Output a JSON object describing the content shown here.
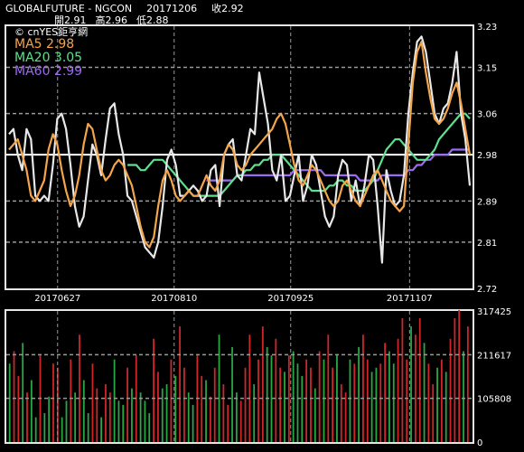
{
  "header": {
    "symbol": "GLOBALFUTURE - NGCON",
    "date": "20171206",
    "close_label": "收2.92",
    "open_label": "開2.91",
    "high_label": "高2.96",
    "low_label": "低2.88"
  },
  "legend": {
    "brand": "© cnYES鉅亨網",
    "ma5": "MA5 2.98",
    "ma20": "MA20 3.05",
    "ma60": "MA60 2.99"
  },
  "colors": {
    "price": "#e8e8e8",
    "ma5": "#f5a54a",
    "ma20": "#5ee08e",
    "ma60": "#9b6cf0",
    "vol_up": "#d0262a",
    "vol_down": "#28a745",
    "grid": "#9a9a9a",
    "last_price_line": "#ffffff"
  },
  "chart_data": [
    {
      "type": "line",
      "y_ticks": [
        "3.23",
        "3.15",
        "3.06",
        "2.98",
        "2.89",
        "2.81",
        "2.72"
      ],
      "ylim": [
        2.72,
        3.23
      ],
      "x_tick_labels": [
        "20170627",
        "20170810",
        "20170925",
        "20171107"
      ],
      "last_price_line": 2.98,
      "series": [
        {
          "name": "MA5",
          "values": [
            2.99,
            3.0,
            3.01,
            2.98,
            2.95,
            2.9,
            2.89,
            2.91,
            2.93,
            2.99,
            3.02,
            3.0,
            2.95,
            2.91,
            2.88,
            2.9,
            2.94,
            3.0,
            3.04,
            3.03,
            2.99,
            2.95,
            2.93,
            2.94,
            2.96,
            2.97,
            2.96,
            2.94,
            2.92,
            2.88,
            2.84,
            2.81,
            2.8,
            2.82,
            2.88,
            2.93,
            2.95,
            2.93,
            2.9,
            2.89,
            2.9,
            2.91,
            2.9,
            2.9,
            2.92,
            2.94,
            2.92,
            2.91,
            2.93,
            2.98,
            3.0,
            2.99,
            2.96,
            2.95,
            2.96,
            2.98,
            2.99,
            3.0,
            3.01,
            3.02,
            3.03,
            3.05,
            3.06,
            3.04,
            3.0,
            2.96,
            2.93,
            2.92,
            2.94,
            2.96,
            2.95,
            2.93,
            2.91,
            2.89,
            2.88,
            2.89,
            2.92,
            2.93,
            2.91,
            2.89,
            2.88,
            2.9,
            2.92,
            2.94,
            2.95,
            2.93,
            2.91,
            2.89,
            2.88,
            2.87,
            2.88,
            3.0,
            3.12,
            3.18,
            3.2,
            3.14,
            3.09,
            3.05,
            3.04,
            3.05,
            3.07,
            3.1,
            3.12,
            3.08,
            3.03,
            2.98
          ]
        },
        {
          "name": "MA20",
          "values": [
            2.96,
            2.96,
            2.96,
            2.95,
            2.95,
            2.96,
            2.97,
            2.97,
            2.97,
            2.96,
            2.95,
            2.94,
            2.93,
            2.92,
            2.91,
            2.9,
            2.9,
            2.9,
            2.9,
            2.9,
            2.9,
            2.9,
            2.91,
            2.92,
            2.93,
            2.94,
            2.94,
            2.95,
            2.95,
            2.96,
            2.96,
            2.97,
            2.97,
            2.98,
            2.98,
            2.98,
            2.97,
            2.96,
            2.95,
            2.94,
            2.93,
            2.92,
            2.91,
            2.91,
            2.91,
            2.91,
            2.92,
            2.92,
            2.93,
            2.93,
            2.92,
            2.92,
            2.91,
            2.91,
            2.91,
            2.92,
            2.93,
            2.95,
            2.97,
            2.99,
            3.0,
            3.01,
            3.01,
            3.0,
            2.99,
            2.98,
            2.97,
            2.97,
            2.97,
            2.98,
            2.99,
            3.01,
            3.02,
            3.03,
            3.04,
            3.05,
            3.06,
            3.06,
            3.05
          ],
          "start_index": 27
        },
        {
          "name": "MA60",
          "values": [
            2.93,
            2.93,
            2.93,
            2.93,
            2.93,
            2.93,
            2.93,
            2.94,
            2.94,
            2.94,
            2.94,
            2.94,
            2.94,
            2.94,
            2.94,
            2.94,
            2.94,
            2.94,
            2.94,
            2.94,
            2.95,
            2.95,
            2.95,
            2.95,
            2.95,
            2.95,
            2.95,
            2.94,
            2.94,
            2.94,
            2.94,
            2.94,
            2.94,
            2.94,
            2.94,
            2.93,
            2.93,
            2.93,
            2.93,
            2.93,
            2.94,
            2.94,
            2.94,
            2.94,
            2.94,
            2.94,
            2.95,
            2.95,
            2.96,
            2.96,
            2.97,
            2.97,
            2.98,
            2.98,
            2.98,
            2.98,
            2.99,
            2.99,
            2.99,
            2.99,
            2.99
          ],
          "start_index": 45
        },
        {
          "name": "Price",
          "values": [
            3.02,
            3.03,
            2.98,
            2.95,
            3.03,
            3.01,
            2.9,
            2.89,
            2.9,
            2.89,
            2.96,
            3.05,
            3.06,
            3.03,
            2.96,
            2.88,
            2.84,
            2.86,
            2.93,
            3.0,
            2.98,
            2.94,
            3.01,
            3.07,
            3.08,
            3.02,
            2.98,
            2.9,
            2.89,
            2.86,
            2.83,
            2.8,
            2.79,
            2.78,
            2.81,
            2.88,
            2.97,
            2.99,
            2.96,
            2.9,
            2.9,
            2.91,
            2.92,
            2.91,
            2.89,
            2.9,
            2.95,
            2.96,
            2.88,
            2.98,
            3.0,
            3.01,
            2.94,
            2.93,
            2.98,
            3.03,
            3.02,
            3.14,
            3.09,
            3.04,
            2.95,
            2.93,
            2.98,
            2.89,
            2.9,
            2.94,
            2.98,
            2.89,
            2.92,
            2.98,
            2.96,
            2.91,
            2.86,
            2.84,
            2.86,
            2.94,
            2.97,
            2.96,
            2.89,
            2.93,
            2.88,
            2.92,
            2.98,
            2.97,
            2.88,
            2.77,
            2.95,
            2.91,
            2.88,
            2.89,
            2.94,
            3.06,
            3.14,
            3.2,
            3.21,
            3.18,
            3.12,
            3.06,
            3.04,
            3.07,
            3.08,
            3.12,
            3.18,
            3.06,
            3.01,
            2.92
          ]
        }
      ]
    },
    {
      "type": "bar",
      "y_ticks": [
        "317425",
        "211617",
        "105808",
        "0"
      ],
      "ylim": [
        0,
        317425
      ],
      "values": [
        190000,
        220000,
        160000,
        240000,
        120000,
        150000,
        60000,
        210000,
        70000,
        110000,
        190000,
        180000,
        60000,
        100000,
        200000,
        120000,
        260000,
        150000,
        70000,
        190000,
        130000,
        60000,
        140000,
        120000,
        200000,
        100000,
        90000,
        180000,
        130000,
        210000,
        120000,
        100000,
        70000,
        250000,
        170000,
        130000,
        140000,
        200000,
        160000,
        280000,
        180000,
        120000,
        90000,
        210000,
        160000,
        150000,
        110000,
        180000,
        260000,
        140000,
        90000,
        230000,
        120000,
        100000,
        180000,
        260000,
        140000,
        200000,
        280000,
        230000,
        210000,
        250000,
        180000,
        170000,
        210000,
        220000,
        190000,
        160000,
        200000,
        180000,
        130000,
        220000,
        200000,
        260000,
        180000,
        210000,
        140000,
        120000,
        200000,
        190000,
        230000,
        260000,
        200000,
        170000,
        180000,
        190000,
        240000,
        220000,
        190000,
        250000,
        300000,
        200000,
        280000,
        260000,
        300000,
        240000,
        190000,
        140000,
        180000,
        200000,
        170000,
        250000,
        300000,
        320000,
        220000,
        280000
      ],
      "up": [
        0,
        1,
        1,
        0,
        1,
        0,
        0,
        1,
        0,
        0,
        1,
        1,
        0,
        0,
        1,
        0,
        1,
        0,
        0,
        1,
        1,
        0,
        1,
        1,
        0,
        0,
        0,
        1,
        0,
        1,
        0,
        0,
        0,
        1,
        1,
        0,
        0,
        1,
        0,
        1,
        1,
        0,
        0,
        1,
        1,
        0,
        1,
        1,
        0,
        1,
        1,
        0,
        0,
        1,
        1,
        1,
        0,
        1,
        1,
        0,
        0,
        1,
        1,
        0,
        1,
        0,
        0,
        0,
        1,
        1,
        0,
        1,
        0,
        1,
        1,
        0,
        1,
        1,
        0,
        1,
        0,
        1,
        1,
        0,
        0,
        1,
        1,
        0,
        0,
        1,
        1,
        1,
        0,
        1,
        1,
        0,
        1,
        1,
        0,
        1,
        0,
        1,
        1,
        1,
        0,
        1
      ]
    }
  ]
}
